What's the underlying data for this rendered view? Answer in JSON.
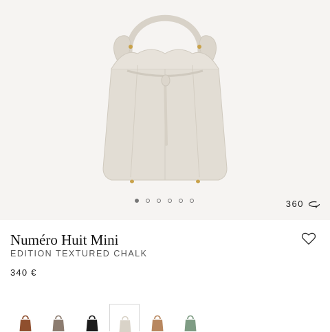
{
  "product": {
    "name": "Numéro Huit Mini",
    "edition": "EDITION TEXTURED CHALK",
    "price": "340 €",
    "gallery_pages": 6,
    "active_page": 1
  },
  "view360": {
    "label": "360",
    "icon": "rotate-360-icon"
  },
  "wishlist": {
    "icon": "heart-outline-icon"
  },
  "swatches": [
    {
      "color": "#8f4f2e",
      "selected": false
    },
    {
      "color": "#8c7c70",
      "selected": false
    },
    {
      "color": "#1c1c1c",
      "selected": false
    },
    {
      "color": "#d9d3c8",
      "selected": true
    },
    {
      "color": "#b8875f",
      "selected": false
    },
    {
      "color": "#7f9c84",
      "selected": false
    }
  ],
  "colors": {
    "hero_bg": "#f6f4f2",
    "bag": "#e2ddd4",
    "bag_shadow": "#cfc9be",
    "hardware": "#c9a24a"
  }
}
